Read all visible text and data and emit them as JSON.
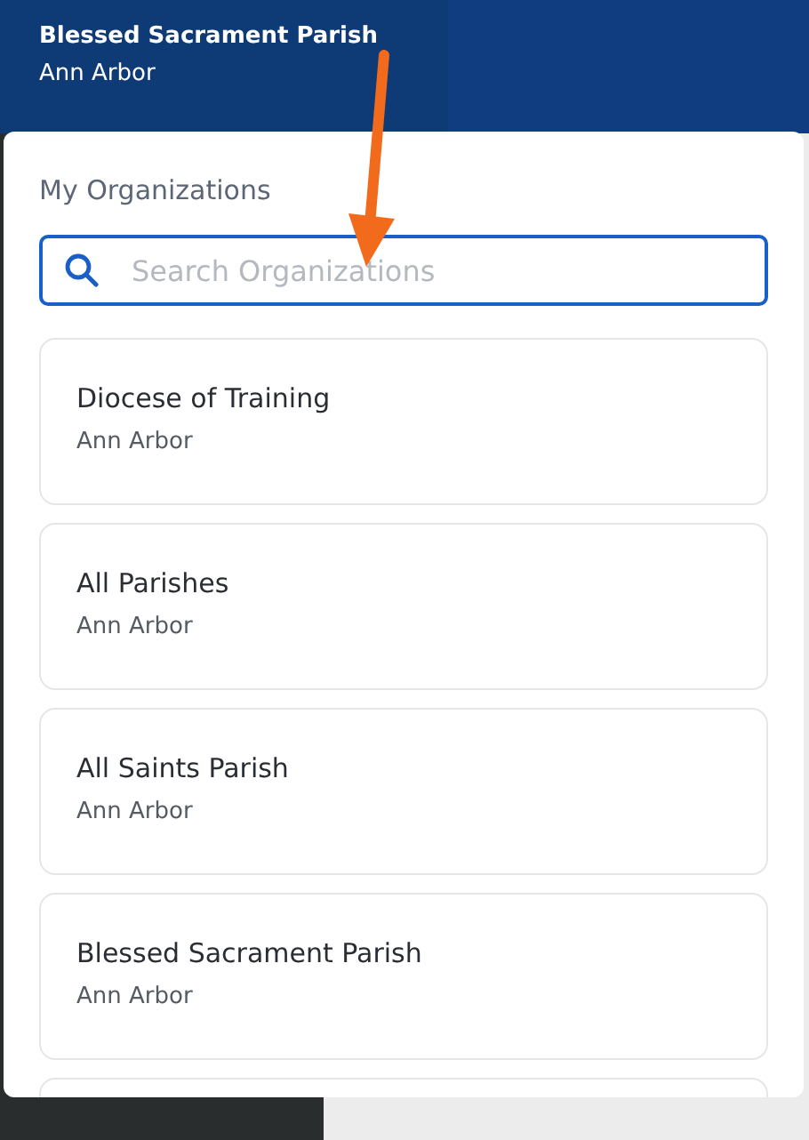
{
  "header": {
    "title": "Blessed Sacrament Parish",
    "subtitle": "Ann Arbor"
  },
  "panel": {
    "heading": "My Organizations",
    "search": {
      "placeholder": "Search Organizations"
    },
    "organizations": [
      {
        "name": "Diocese of Training",
        "location": "Ann Arbor"
      },
      {
        "name": "All Parishes",
        "location": "Ann Arbor"
      },
      {
        "name": "All Saints Parish",
        "location": "Ann Arbor"
      },
      {
        "name": "Blessed Sacrament Parish",
        "location": "Ann Arbor"
      }
    ]
  }
}
